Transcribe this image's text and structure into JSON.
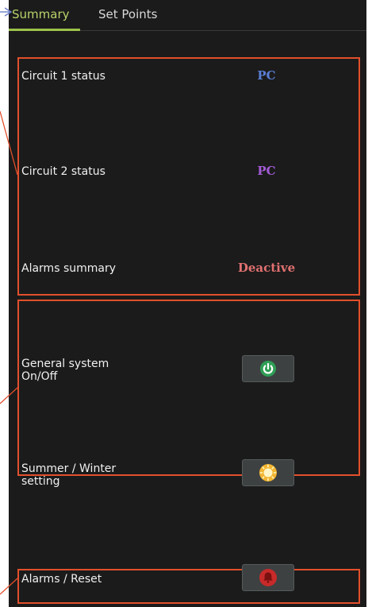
{
  "tabs": {
    "summary": "Summary",
    "set_points": "Set Points"
  },
  "status": {
    "circuit1_label": "Circuit 1 status",
    "circuit1_value": "PC",
    "circuit2_label": "Circuit 2 status",
    "circuit2_value": "PC",
    "alarms_label": "Alarms summary",
    "alarms_value": "Deactive"
  },
  "controls": {
    "general_line1": "General system",
    "general_line2": "On/Off",
    "season_line1": "Summer / Winter",
    "season_line2": "setting",
    "alarms_reset": "Alarms / Reset"
  },
  "icons": {
    "power": "power-icon",
    "sun": "sun-icon",
    "bell": "bell-icon"
  },
  "colors": {
    "circuit1": "#5b7fd6",
    "circuit2": "#a45bd6",
    "alarms": "#e07070",
    "power": "#3ccb6e",
    "sun": "#f2b531",
    "bell": "#c82a2a",
    "frame": "#e2502c",
    "active_tab": "#9cc24a"
  }
}
